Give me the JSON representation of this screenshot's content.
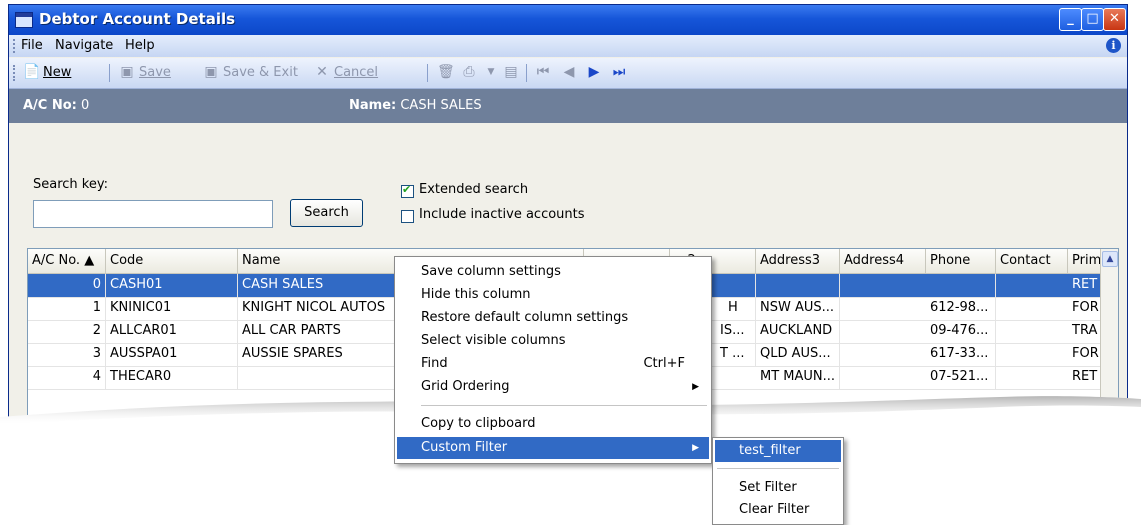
{
  "window": {
    "title": "Debtor Account Details",
    "buttons": [
      "minimize",
      "maximize",
      "close"
    ]
  },
  "menu": {
    "items": [
      "File",
      "Navigate",
      "Help"
    ]
  },
  "toolbar": {
    "new": "New",
    "save": "Save",
    "save_exit": "Save & Exit",
    "cancel": "Cancel",
    "icons": [
      "new-icon",
      "save-icon",
      "save-exit-icon",
      "cancel-icon",
      "delete-icon",
      "print-icon",
      "dropdown-icon",
      "report-icon",
      "first-icon",
      "prev-icon",
      "next-icon",
      "last-icon"
    ]
  },
  "header": {
    "ac_label": "A/C No:",
    "ac_value": "0",
    "name_label": "Name:",
    "name_value": "CASH SALES"
  },
  "search": {
    "label": "Search key:",
    "value": "",
    "button": "Search",
    "extended": "Extended search",
    "extended_checked": true,
    "inactive": "Include inactive accounts",
    "inactive_checked": false
  },
  "grid": {
    "columns": [
      "A/C No. ▲",
      "Code",
      "Name",
      "",
      "ss2",
      "Address3",
      "Address4",
      "Phone",
      "Contact",
      "Prim"
    ],
    "rows": [
      {
        "ac": "0",
        "code": "CASH01",
        "name": "CASH SALES",
        "addr2": "",
        "addr3": "",
        "addr4": "",
        "phone": "",
        "contact": "",
        "prim": "RET"
      },
      {
        "ac": "1",
        "code": "KNINIC01",
        "name": "KNIGHT NICOL AUTOS",
        "addr2": "H",
        "addr3": "NSW AUS...",
        "addr4": "",
        "phone": "612-98...",
        "contact": "",
        "prim": "FOR"
      },
      {
        "ac": "2",
        "code": "ALLCAR01",
        "name": "ALL CAR PARTS",
        "addr2": "IS...",
        "addr3": "AUCKLAND",
        "addr4": "",
        "phone": "09-476...",
        "contact": "",
        "prim": "TRA"
      },
      {
        "ac": "3",
        "code": "AUSSPA01",
        "name": "AUSSIE SPARES",
        "addr2": "T ...",
        "addr3": "QLD AUS...",
        "addr4": "",
        "phone": "617-33...",
        "contact": "",
        "prim": "FOR"
      },
      {
        "ac": "4",
        "code": "THECAR0",
        "name": "",
        "addr2": "",
        "addr3": "MT MAUN...",
        "addr4": "",
        "phone": "07-521...",
        "contact": "",
        "prim": "RET"
      }
    ]
  },
  "context_menu": {
    "items": [
      {
        "label": "Save column settings"
      },
      {
        "label": "Hide this column"
      },
      {
        "label": "Restore default column settings"
      },
      {
        "label": "Select visible columns"
      },
      {
        "label": "Find",
        "shortcut": "Ctrl+F"
      },
      {
        "label": "Grid Ordering",
        "submenu": true
      },
      {
        "label": "Copy to clipboard"
      },
      {
        "label": "Custom Filter",
        "submenu": true,
        "highlighted": true
      }
    ]
  },
  "submenu": {
    "items": [
      "test_filter",
      "Set Filter",
      "Clear Filter"
    ],
    "highlighted": "test_filter"
  },
  "colors": {
    "titlebar": "#1656d9",
    "selection": "#316ac5",
    "header_band": "#6e7f9a"
  }
}
